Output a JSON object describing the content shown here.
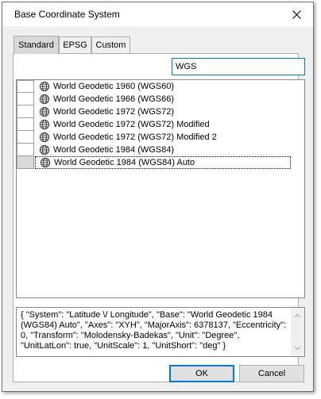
{
  "window": {
    "title": "Base Coordinate System",
    "close_icon": "close-icon"
  },
  "tabs": [
    {
      "label": "Standard",
      "active": true
    },
    {
      "label": "EPSG",
      "active": false
    },
    {
      "label": "Custom",
      "active": false
    }
  ],
  "search": {
    "value": "WGS"
  },
  "list": {
    "item_icon": "globe-icon",
    "items": [
      {
        "label": "World Geodetic 1960 (WGS60)"
      },
      {
        "label": "World Geodetic 1966 (WGS66)"
      },
      {
        "label": "World Geodetic 1972 (WGS72)"
      },
      {
        "label": "World Geodetic 1972 (WGS72) Modified"
      },
      {
        "label": "World Geodetic 1972 (WGS72) Modified 2"
      },
      {
        "label": "World Geodetic 1984 (WGS84)"
      },
      {
        "label": "World Geodetic 1984 (WGS84) Auto",
        "selected": true
      }
    ]
  },
  "description": {
    "text": "{ \"System\": \"Latitude \\/ Longitude\", \"Base\": \"World Geodetic 1984 (WGS84) Auto\", \"Axes\": \"XYH\", \"MajorAxis\": 6378137, \"Eccentricity\": 0, \"Transform\": \"Molodensky-Badekas\", \"Unit\": \"Degree\", \"UnitLatLon\": true, \"UnitScale\": 1, \"UnitShort\": \"deg\" }"
  },
  "buttons": {
    "ok": "OK",
    "cancel": "Cancel"
  },
  "colors": {
    "accent": "#0078d7",
    "dialog_bg": "#f0f0f0",
    "selected_gutter": "#d9d9d9"
  }
}
